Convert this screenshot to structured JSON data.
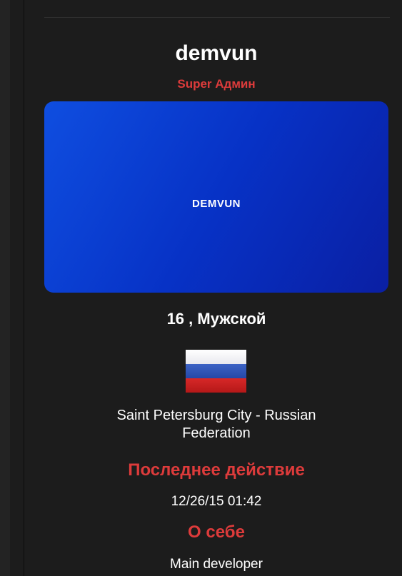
{
  "profile": {
    "username": "demvun",
    "role": "Super Админ",
    "banner_text": "DEMVUN",
    "age_gender": "16 , Мужской",
    "flag_icon": "russia-flag-icon",
    "location_line1": "Saint Petersburg City - Russian",
    "location_line2": "Federation",
    "last_action_title": "Последнее действие",
    "last_action_value": "12/26/15 01:42",
    "about_title": "О себе",
    "about_value": "Main developer"
  },
  "colors": {
    "background": "#1c1c1c",
    "accent_red": "#dd3b3b",
    "banner_blue": "#0732c6",
    "text": "#ffffff"
  }
}
